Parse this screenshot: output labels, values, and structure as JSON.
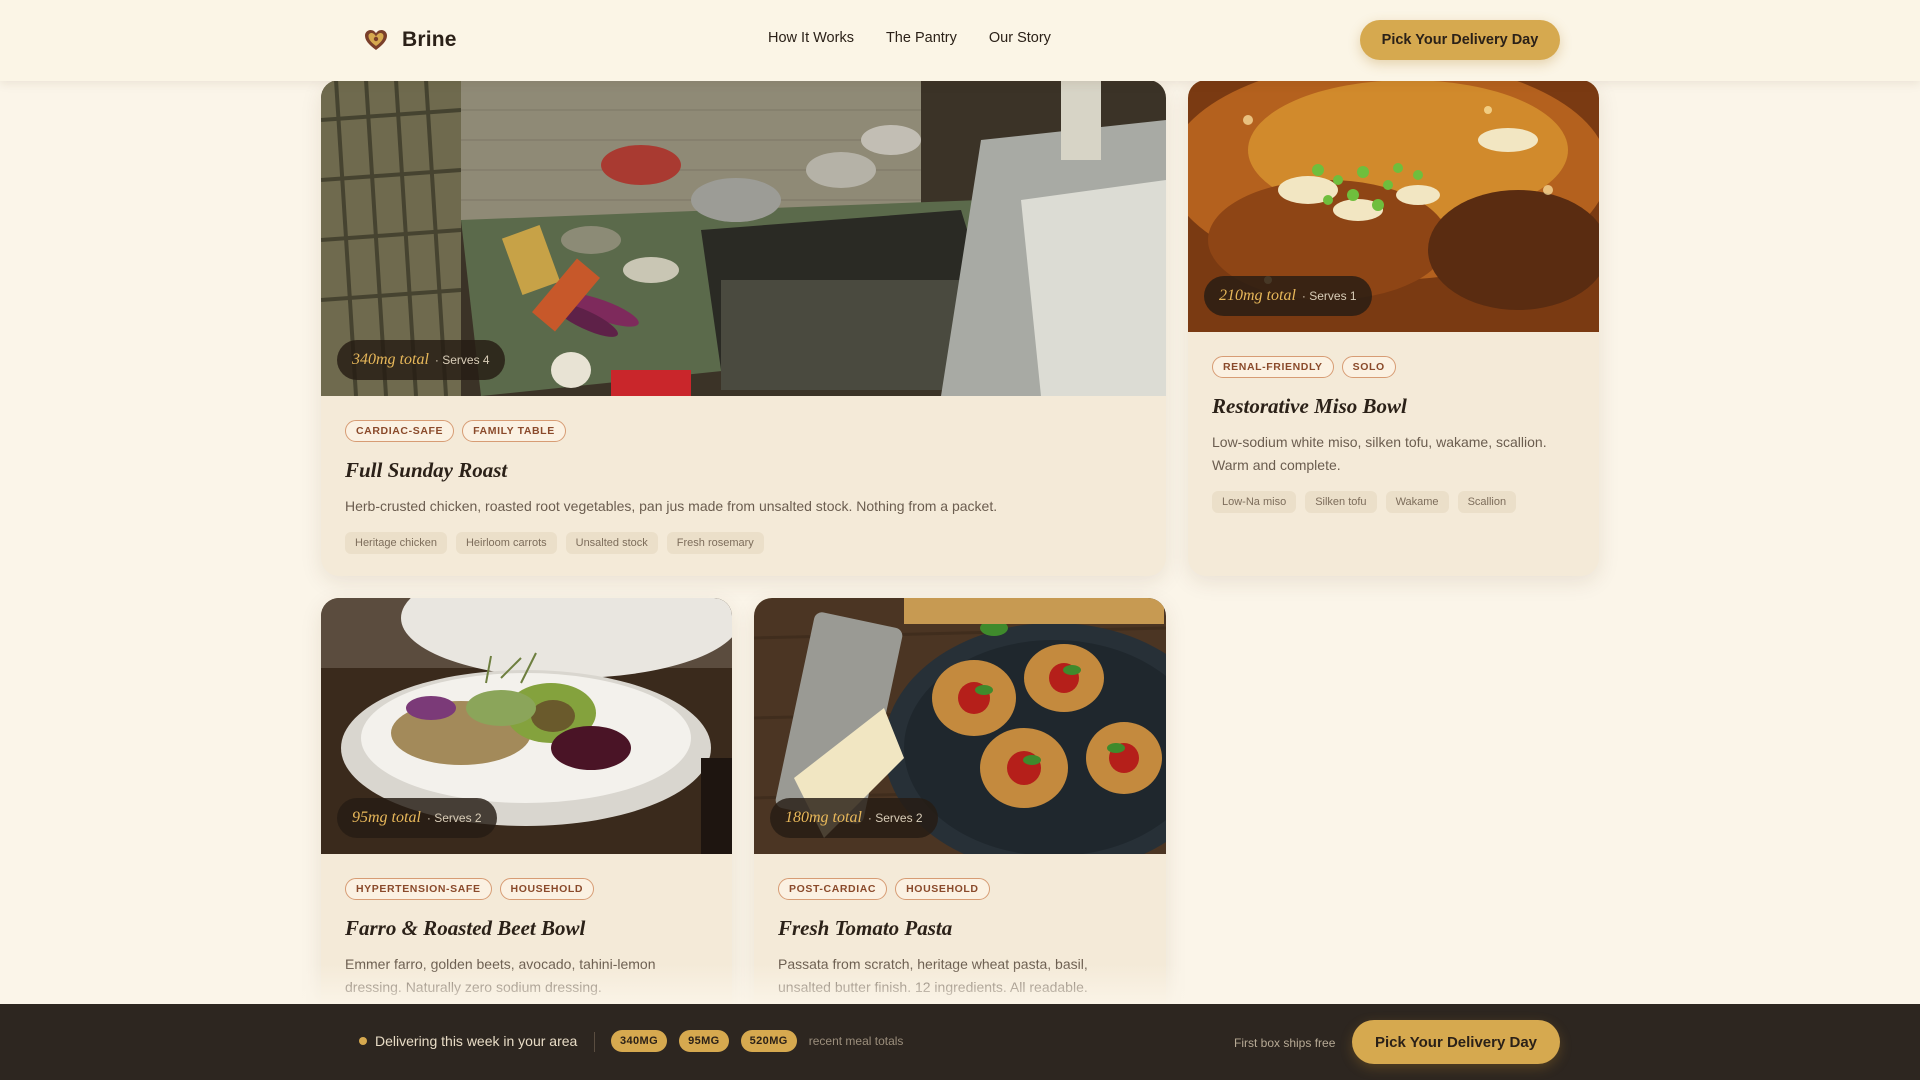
{
  "brand": {
    "name": "Brine",
    "icon": "heart-icon",
    "accent": "#d6a94f"
  },
  "nav": {
    "items": [
      "How It Works",
      "The Pantry",
      "Our Story"
    ]
  },
  "header": {
    "cta_label": "Pick Your Delivery Day"
  },
  "cards": [
    {
      "sodium": "340mg total",
      "serves": "· Serves 4",
      "tags": [
        "CARDIAC-SAFE",
        "FAMILY TABLE"
      ],
      "title": "Full Sunday Roast",
      "description": "Herb-crusted chicken, roasted root vegetables, pan jus made from unsalted stock. Nothing from a packet.",
      "ingredients": [
        "Heritage chicken",
        "Heirloom carrots",
        "Unsalted stock",
        "Fresh rosemary"
      ]
    },
    {
      "sodium": "210mg total",
      "serves": "· Serves 1",
      "tags": [
        "RENAL-FRIENDLY",
        "SOLO"
      ],
      "title": "Restorative Miso Bowl",
      "description": "Low-sodium white miso, silken tofu, wakame, scallion. Warm and complete.",
      "ingredients": [
        "Low-Na miso",
        "Silken tofu",
        "Wakame",
        "Scallion"
      ]
    },
    {
      "sodium": "95mg total",
      "serves": "· Serves 2",
      "tags": [
        "HYPERTENSION-SAFE",
        "HOUSEHOLD"
      ],
      "title": "Farro & Roasted Beet Bowl",
      "description": "Emmer farro, golden beets, avocado, tahini-lemon dressing. Naturally zero sodium dressing."
    },
    {
      "sodium": "180mg total",
      "serves": "· Serves 2",
      "tags": [
        "POST-CARDIAC",
        "HOUSEHOLD"
      ],
      "title": "Fresh Tomato Pasta",
      "description": "Passata from scratch, heritage wheat pasta, basil, unsalted butter finish. 12 ingredients. All readable."
    }
  ],
  "bottom_bar": {
    "status": "Delivering this week in your area",
    "chips": [
      "340MG",
      "95MG",
      "520MG"
    ],
    "chips_caption": "recent meal totals",
    "shipping_note": "First box ships free",
    "cta_label": "Pick Your Delivery Day"
  }
}
